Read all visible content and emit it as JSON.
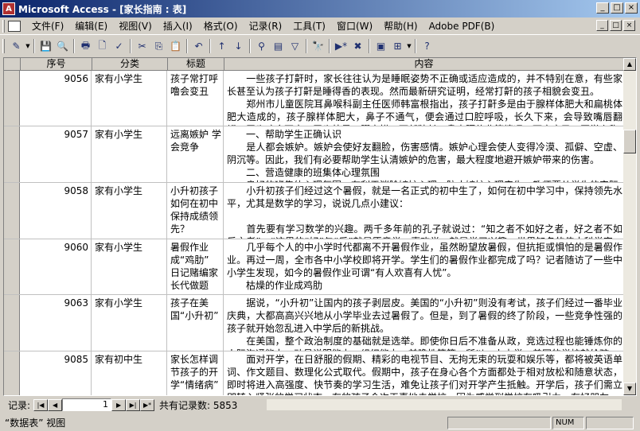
{
  "window": {
    "title": "Microsoft Access - [家长指南 : 表]",
    "app_icon": "access-app-icon",
    "controls": [
      "_",
      "□",
      "×"
    ]
  },
  "menu": {
    "items": [
      "文件(F)",
      "编辑(E)",
      "视图(V)",
      "插入(I)",
      "格式(O)",
      "记录(R)",
      "工具(T)",
      "窗口(W)",
      "帮助(H)",
      "Adobe PDF(B)"
    ],
    "doc_controls": [
      "_",
      "□",
      "×"
    ]
  },
  "toolbar": {
    "icons": [
      "view-icon",
      "save-icon",
      "file-search-icon",
      "print-icon",
      "print-preview-icon",
      "spelling-icon",
      "cut-icon",
      "copy-icon",
      "paste-icon",
      "undo-icon",
      "sort-ascending-icon",
      "sort-descending-icon",
      "filter-by-selection-icon",
      "filter-by-form-icon",
      "apply-filter-icon",
      "find-icon",
      "new-record-icon",
      "delete-record-icon",
      "database-window-icon",
      "new-object-icon",
      "help-icon"
    ],
    "symbols": [
      "✎",
      "💾",
      "🔍",
      "🖶",
      "🗋",
      "✓",
      "✂",
      "⎘",
      "📋",
      "↶",
      "↑",
      "↓",
      "⚲",
      "▤",
      "▽",
      "🔭",
      "▶*",
      "✖",
      "▣",
      "⊞",
      "?"
    ]
  },
  "table": {
    "columns": [
      "序号",
      "分类",
      "标题",
      "内容"
    ],
    "rows": [
      {
        "seq": "9056",
        "category": "家有小学生",
        "title": "孩子常打呼噜会变丑",
        "content": "　　一些孩子打鼾时，家长往往认为是睡眠姿势不正确或适应造成的，并不特别在意，有些家长甚至认为孩子打鼾是睡得香的表现。然而最新研究证明，经常打鼾的孩子相貌会变丑。\n　　郑州市儿童医院耳鼻喉科副主任医师韩富根指出，孩子打鼾多是由于腺样体肥大和扁桃体肥大造成的，孩子腺样体肥大，鼻子不通气，便会通过口腔呼吸，长久下来，会导致嘴唇翻翘、牙齿咬合不良、牙齿外暴、腭高拱、面部狭长、鼻中隔偏曲等情况，面容变丑，医学上称"
      },
      {
        "seq": "9057",
        "category": "家有小学生",
        "title": "远离嫉妒 学会竞争",
        "content": "　　一、帮助学生正确认识\n　　是人都会嫉妒。嫉妒会使好友翻脸，伤害感情。嫉妒心理会使人变得冷漠、孤僻、空虚、阴沉等。因此，我们有必要帮助学生认清嫉妒的危害，最大程度地避开嫉妒带来的伤害。\n　　二、营造健康的班集体心理氛围\n　　良好的班集体心理氛围，有利于消除嫉妒心理，防止嫉妒心理产生。教师要从学生的实际"
      },
      {
        "seq": "9058",
        "category": "家有小学生",
        "title": "小升初孩子如何在初中保持成绩领先？",
        "content": "　　小升初孩子们经过这个暑假，就是一名正式的初中生了，如何在初中学习中，保持领先水平，尤其是数学的学习，说说几点小建议：\n\n　　首先要有学习数学的兴趣。两千多年前的孔子就说过：“知之者不如好之者，好之者不如乐之者”。“这里的“好”与“乐”就是愿意学、喜欢学，就是学习兴趣，世界知名的伟大科学家、相"
      },
      {
        "seq": "9060",
        "category": "家有小学生",
        "title": "暑假作业成“鸡肋” 日记赌编家长代做题",
        "content": "　　几乎每个人的中小学时代都离不开暑假作业，虽然盼望放暑假，但抗拒或惧怕的是暑假作业。再过一周，全市各中小学校即将开学。学生们的暑假作业都完成了吗？记者随访了一些中小学生发现，如今的暑假作业可谓“有人欢喜有人忧”。\n　　枯燥的作业成鸡肋"
      },
      {
        "seq": "9063",
        "category": "家有小学生",
        "title": "孩子在美国“小升初”",
        "content": "　　据说，“小升初”让国内的孩子剥层皮。美国的“小升初”则没有考试，孩子们经过一番毕业庆典，大都高高兴兴地从小学毕业去过暑假了。但是，到了暑假的终了阶段，一些竞争性强的孩子就开始忽乱进入中学后的新挑战。\n　　在美国，整个政治制度的基础就是选举。即使你日后不准备从政，竞选过程也能锤炼你的人际沟通能力、动员说服能力、组织能力、前瞻性等等。所以，上中学，美国的学校就给孩"
      },
      {
        "seq": "9085",
        "category": "家有初中生",
        "title": "家长怎样调节孩子的开学“情绪病”",
        "content": "　　面对开学，在日舒服的假期、精彩的电视节目、无拘无束的玩耍和娱乐等，都将被英语单词、作文题目、数理化公式取代。假期中，孩子在身心各个方面都处于相对放松和随意状态，即时将进入高强度、快节奏的学习生活，难免让孩子们对开学产生抵触。开学后，孩子们需立即转入紧张的学习状态，有的孩子会次天喜地去学校，因为感觉到学校有吸引力，有好朋友，"
      }
    ]
  },
  "navigation": {
    "label": "记录:",
    "current": "1",
    "total_text": "共有记录数: 5853",
    "buttons": [
      "|◀",
      "◀",
      "▶",
      "▶|",
      "▶*"
    ]
  },
  "status": {
    "text": "“数据表” 视图",
    "indicator": "NUM"
  }
}
